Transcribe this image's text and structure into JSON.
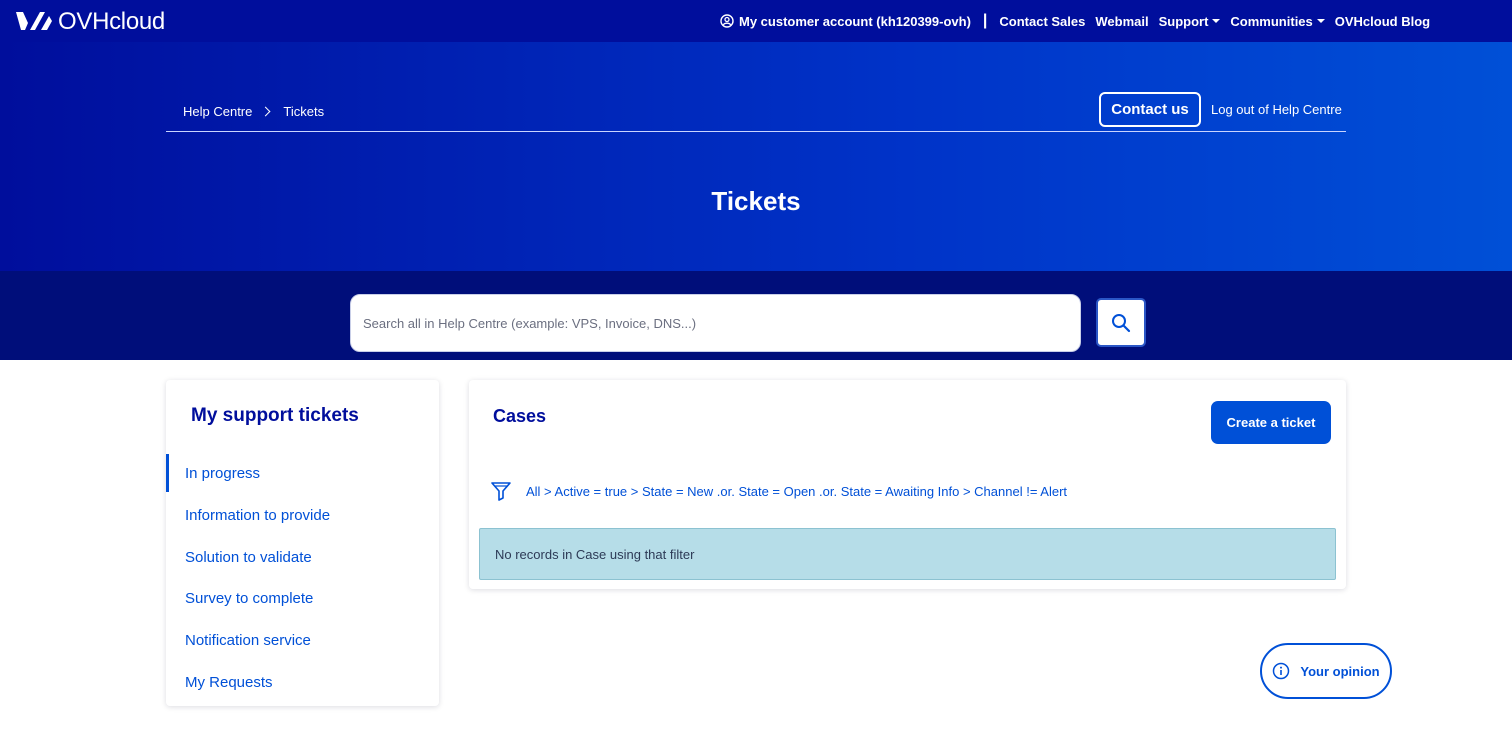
{
  "header": {
    "brand": "OVHcloud",
    "account_label": "My customer account (kh120399-ovh)",
    "separator": "|",
    "nav": [
      {
        "label": "Contact Sales",
        "has_caret": false
      },
      {
        "label": "Webmail",
        "has_caret": false
      },
      {
        "label": "Support",
        "has_caret": true
      },
      {
        "label": "Communities",
        "has_caret": true
      },
      {
        "label": "OVHcloud Blog",
        "has_caret": false
      }
    ]
  },
  "hero": {
    "breadcrumb": [
      "Help Centre",
      "Tickets"
    ],
    "contact_label": "Contact us",
    "logout_label": "Log out of Help Centre",
    "title": "Tickets"
  },
  "search": {
    "placeholder": "Search all in Help Centre (example: VPS, Invoice, DNS...)",
    "value": ""
  },
  "sidebar": {
    "title": "My support tickets",
    "items": [
      {
        "label": "In progress",
        "active": true
      },
      {
        "label": "Information to provide",
        "active": false
      },
      {
        "label": "Solution to validate",
        "active": false
      },
      {
        "label": "Survey to complete",
        "active": false
      },
      {
        "label": "Notification service",
        "active": false
      },
      {
        "label": "My Requests",
        "active": false
      }
    ]
  },
  "cases": {
    "title": "Cases",
    "create_label": "Create a ticket",
    "filter": "All > Active = true > State = New .or. State = Open .or. State = Awaiting Info > Channel != Alert",
    "empty_message": "No records in Case using that filter"
  },
  "feedback": {
    "label": "Your opinion"
  },
  "colors": {
    "brand_dark": "#000e9c",
    "brand_blue": "#0050d7",
    "search_band": "#000e7a",
    "info_bg": "#b6dde8"
  }
}
